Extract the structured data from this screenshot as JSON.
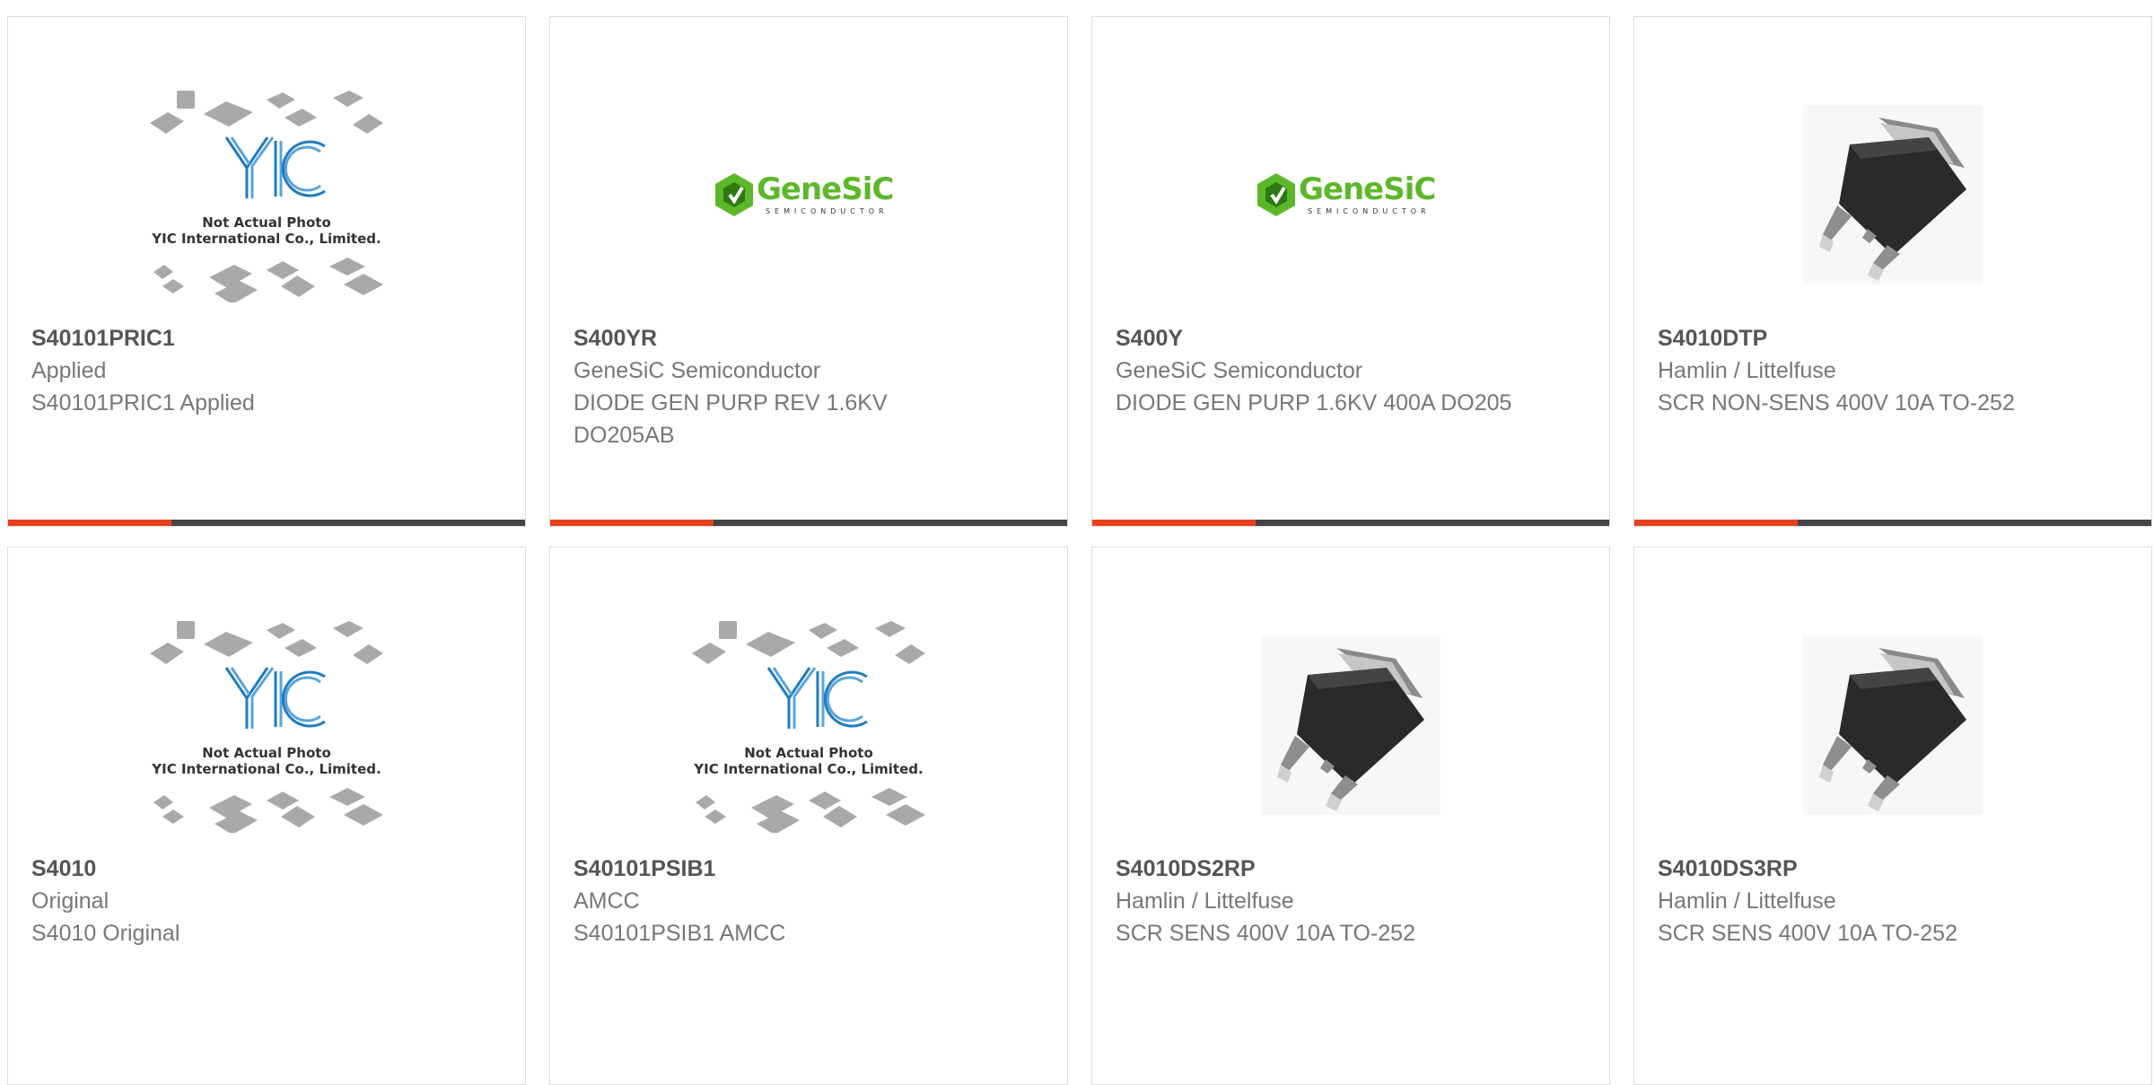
{
  "products": [
    {
      "part": "S40101PRIC1",
      "manufacturer": "Applied",
      "description": "S40101PRIC1 Applied",
      "image": "placeholder"
    },
    {
      "part": "S400YR",
      "manufacturer": "GeneSiC Semiconductor",
      "description": "DIODE GEN PURP REV 1.6KV DO205AB",
      "image": "genesic-logo"
    },
    {
      "part": "S400Y",
      "manufacturer": "GeneSiC Semiconductor",
      "description": "DIODE GEN PURP 1.6KV 400A DO205",
      "image": "genesic-logo"
    },
    {
      "part": "S4010DTP",
      "manufacturer": "Hamlin / Littelfuse",
      "description": "SCR NON-SENS 400V 10A TO-252",
      "image": "to252-package"
    },
    {
      "part": "S4010",
      "manufacturer": "Original",
      "description": "S4010 Original",
      "image": "placeholder"
    },
    {
      "part": "S40101PSIB1",
      "manufacturer": "AMCC",
      "description": "S40101PSIB1 AMCC",
      "image": "placeholder"
    },
    {
      "part": "S4010DS2RP",
      "manufacturer": "Hamlin / Littelfuse",
      "description": "SCR SENS 400V 10A TO-252",
      "image": "to252-package"
    },
    {
      "part": "S4010DS3RP",
      "manufacturer": "Hamlin / Littelfuse",
      "description": "SCR SENS 400V 10A TO-252",
      "image": "to252-package"
    }
  ],
  "placeholder": {
    "line1": "Not Actual Photo",
    "line2": "YIC International Co., Limited.",
    "logo_text": "YIC"
  },
  "genesic": {
    "name": "GeneSiC",
    "tagline": "SEMICONDUCTOR"
  },
  "colors": {
    "accent": "#e8401c",
    "bar": "#444444",
    "genesic_green": "#5cb82a",
    "yic_blue": "#1f7bc1"
  }
}
